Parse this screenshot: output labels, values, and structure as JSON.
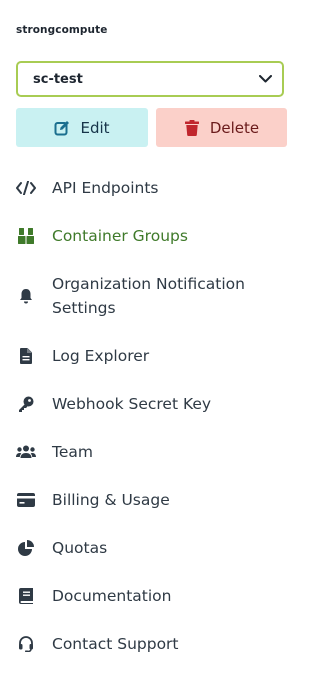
{
  "org": {
    "name": "strongcompute"
  },
  "project_select": {
    "value": "sc-test"
  },
  "actions": {
    "edit_label": "Edit",
    "delete_label": "Delete"
  },
  "nav": {
    "items": [
      {
        "label": "API Endpoints",
        "icon": "code-icon",
        "active": false
      },
      {
        "label": "Container Groups",
        "icon": "boxes-icon",
        "active": true
      },
      {
        "label": "Organization Notification Settings",
        "icon": "bell-icon",
        "active": false
      },
      {
        "label": "Log Explorer",
        "icon": "document-icon",
        "active": false
      },
      {
        "label": "Webhook Secret Key",
        "icon": "key-icon",
        "active": false
      },
      {
        "label": "Team",
        "icon": "users-icon",
        "active": false
      },
      {
        "label": "Billing & Usage",
        "icon": "credit-card-icon",
        "active": false
      },
      {
        "label": "Quotas",
        "icon": "pie-chart-icon",
        "active": false
      },
      {
        "label": "Documentation",
        "icon": "book-icon",
        "active": false
      },
      {
        "label": "Contact Support",
        "icon": "headset-icon",
        "active": false
      }
    ]
  },
  "colors": {
    "accent_green": "#3f7a2a",
    "select_border": "#a8cc53",
    "edit_bg": "#c9f1f2",
    "delete_bg": "#fbd0c9",
    "delete_icon": "#c0262d",
    "edit_icon": "#1b6f8f"
  }
}
